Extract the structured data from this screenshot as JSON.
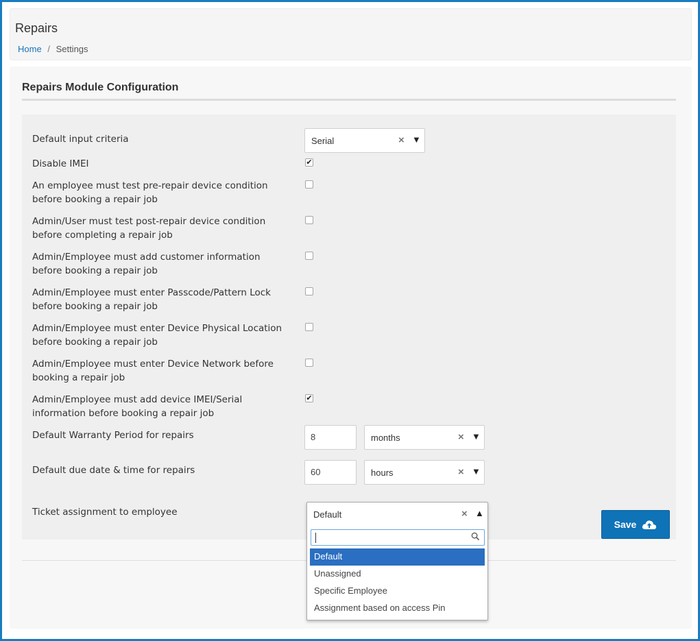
{
  "header": {
    "title": "Repairs",
    "breadcrumb": {
      "home": "Home",
      "separator": "/",
      "current": "Settings"
    }
  },
  "section": {
    "title": "Repairs Module Configuration"
  },
  "fields": {
    "default_input": {
      "label": "Default input criteria",
      "value": "Serial"
    },
    "disable_imei": {
      "label": "Disable IMEI",
      "checked": true
    },
    "pre_repair_test": {
      "label": "An employee must test pre-repair device condition before booking a repair job",
      "checked": false
    },
    "post_repair_test": {
      "label": "Admin/User must test post-repair device condition before completing a repair job",
      "checked": false
    },
    "customer_info": {
      "label": "Admin/Employee must add customer information before booking a repair job",
      "checked": false
    },
    "passcode": {
      "label": "Admin/Employee must enter Passcode/Pattern Lock before booking a repair job",
      "checked": false
    },
    "physical_location": {
      "label": "Admin/Employee must enter Device Physical Location before booking a repair job",
      "checked": false
    },
    "network": {
      "label": "Admin/Employee must enter Device Network before booking a repair job",
      "checked": false
    },
    "imei_serial": {
      "label": "Admin/Employee must add device IMEI/Serial information before booking a repair job",
      "checked": true
    },
    "warranty": {
      "label": "Default Warranty Period for repairs",
      "value": "8",
      "unit": "months"
    },
    "due_date": {
      "label": "Default due date & time for repairs",
      "value": "60",
      "unit": "hours"
    },
    "ticket_assignment": {
      "label": "Ticket assignment to employee",
      "value": "Default",
      "search_value": "",
      "options": [
        "Default",
        "Unassigned",
        "Specific Employee",
        "Assignment based on access Pin"
      ]
    }
  },
  "glyphs": {
    "clear": "×",
    "arrow_down": "▼",
    "arrow_up": "▲",
    "check": "✔"
  },
  "actions": {
    "save_label": "Save"
  },
  "colors": {
    "accent": "#1a7cc0",
    "button": "#0f73b8",
    "selected_option": "#2a6fc1",
    "link": "#1a73b8"
  }
}
